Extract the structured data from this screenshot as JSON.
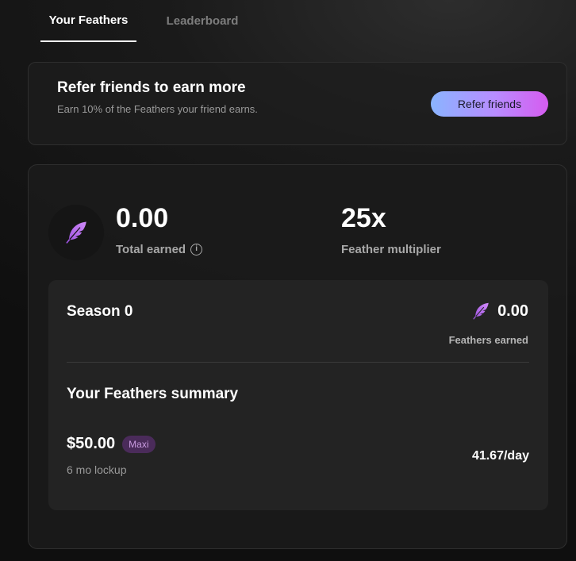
{
  "tabs": [
    {
      "label": "Your Feathers",
      "active": true
    },
    {
      "label": "Leaderboard",
      "active": false
    }
  ],
  "refer": {
    "title": "Refer friends to earn more",
    "subtitle": "Earn 10% of the Feathers your friend earns.",
    "button_label": "Refer friends"
  },
  "stats": {
    "total_earned_value": "0.00",
    "total_earned_label": "Total earned",
    "multiplier_value": "25x",
    "multiplier_label": "Feather multiplier"
  },
  "season": {
    "title": "Season 0",
    "feathers_value": "0.00",
    "feathers_label": "Feathers earned"
  },
  "summary": {
    "title": "Your Feathers summary",
    "amount": "$50.00",
    "badge": "Maxi",
    "lockup": "6 mo lockup",
    "rate": "41.67/day"
  },
  "icons": {
    "feather": "feather-icon",
    "info": "info-icon"
  },
  "colors": {
    "feather_purple": "#b46af0",
    "badge_bg": "#4a2b5a",
    "badge_text": "#c99be0",
    "button_gradient_start": "#8ab4ff",
    "button_gradient_end": "#d65cf0"
  }
}
